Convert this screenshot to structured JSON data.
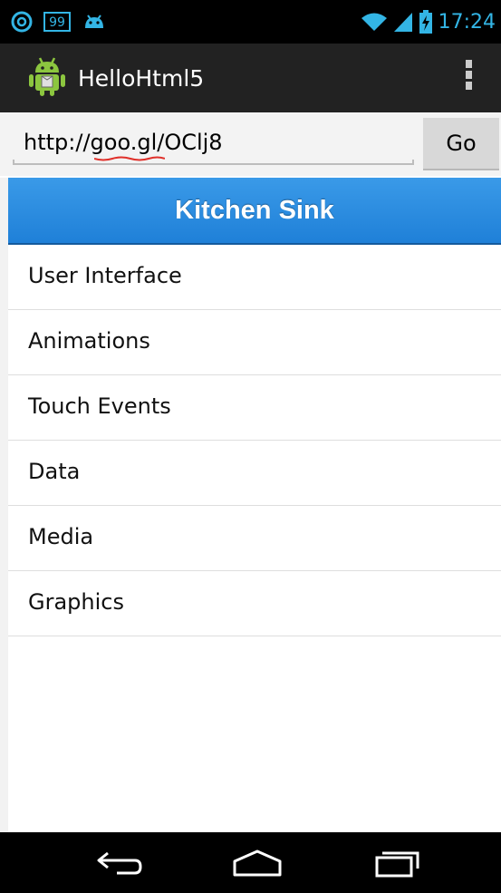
{
  "status_bar": {
    "time": "17:24",
    "notification_badge": "99",
    "icons": [
      "notification-o-icon",
      "badge-99-icon",
      "android-notification-icon",
      "wifi-icon",
      "signal-icon",
      "battery-charging-icon"
    ],
    "time_color": "#33b5e5"
  },
  "action_bar": {
    "title": "HelloHtml5",
    "icon": "android-app-icon",
    "overflow_icon": "overflow-menu-icon"
  },
  "url_bar": {
    "value": "http://goo.gl/OClj8",
    "go_label": "Go"
  },
  "header": {
    "title": "Kitchen Sink",
    "color": "#2a8be0"
  },
  "menu": {
    "items": [
      {
        "label": "User Interface"
      },
      {
        "label": "Animations"
      },
      {
        "label": "Touch Events"
      },
      {
        "label": "Data"
      },
      {
        "label": "Media"
      },
      {
        "label": "Graphics"
      }
    ]
  },
  "nav_bar": {
    "icons": [
      "back-icon",
      "home-icon",
      "recent-apps-icon"
    ]
  }
}
